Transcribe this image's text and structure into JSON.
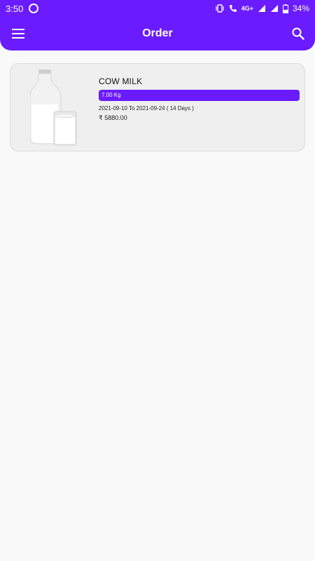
{
  "status_bar": {
    "time": "3:50",
    "network": "4G+",
    "battery": "34%",
    "icons": [
      "whatsapp-icon",
      "vibrate-icon",
      "call-icon",
      "signal-icon",
      "signal-icon",
      "battery-icon"
    ]
  },
  "app_bar": {
    "title": "Order",
    "menu_icon": "menu-icon",
    "search_icon": "search-icon",
    "color": "#6a1bff"
  },
  "orders": [
    {
      "name": "COW MILK",
      "quantity": "7.00  Kg",
      "date_range": "2021-09-10 To 2021-09-24  ( 14 Days )",
      "price": "₹ 5880.00",
      "image": "milk-bottle-and-glass"
    }
  ]
}
